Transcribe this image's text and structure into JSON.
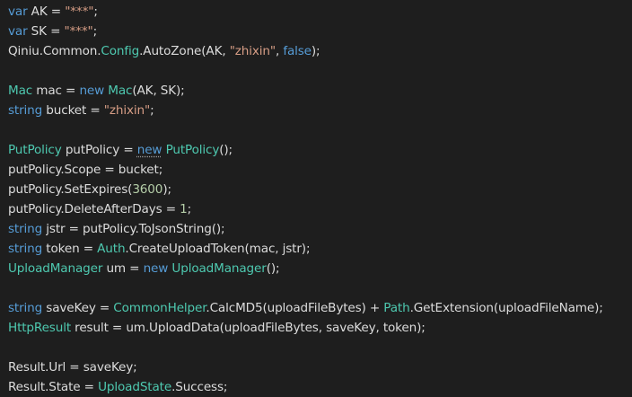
{
  "colors": {
    "background": "#1e1e1e",
    "keyword": "#569cd6",
    "type": "#4ec9b0",
    "string": "#d69d85",
    "number": "#b5cea8",
    "plain": "#dcdcdc"
  },
  "code_lines": [
    [
      {
        "t": "kw",
        "v": "var"
      },
      {
        "t": "plain",
        "v": " AK = "
      },
      {
        "t": "str",
        "v": "\"***\""
      },
      {
        "t": "plain",
        "v": ";"
      }
    ],
    [
      {
        "t": "kw",
        "v": "var"
      },
      {
        "t": "plain",
        "v": " SK = "
      },
      {
        "t": "str",
        "v": "\"***\""
      },
      {
        "t": "plain",
        "v": ";"
      }
    ],
    [
      {
        "t": "plain",
        "v": "Qiniu.Common."
      },
      {
        "t": "type",
        "v": "Config"
      },
      {
        "t": "plain",
        "v": ".AutoZone(AK, "
      },
      {
        "t": "str",
        "v": "\"zhixin\""
      },
      {
        "t": "plain",
        "v": ", "
      },
      {
        "t": "kw",
        "v": "false"
      },
      {
        "t": "plain",
        "v": ");"
      }
    ],
    [],
    [
      {
        "t": "type",
        "v": "Mac"
      },
      {
        "t": "plain",
        "v": " mac = "
      },
      {
        "t": "kw",
        "v": "new"
      },
      {
        "t": "plain",
        "v": " "
      },
      {
        "t": "type",
        "v": "Mac"
      },
      {
        "t": "plain",
        "v": "(AK, SK);"
      }
    ],
    [
      {
        "t": "kw",
        "v": "string"
      },
      {
        "t": "plain",
        "v": " bucket = "
      },
      {
        "t": "str",
        "v": "\"zhixin\""
      },
      {
        "t": "plain",
        "v": ";"
      }
    ],
    [],
    [
      {
        "t": "type",
        "v": "PutPolicy"
      },
      {
        "t": "plain",
        "v": " putPolicy = "
      },
      {
        "t": "kw-sq",
        "v": "new"
      },
      {
        "t": "plain",
        "v": " "
      },
      {
        "t": "type",
        "v": "PutPolicy"
      },
      {
        "t": "plain",
        "v": "();"
      }
    ],
    [
      {
        "t": "plain",
        "v": "putPolicy.Scope = bucket;"
      }
    ],
    [
      {
        "t": "plain",
        "v": "putPolicy.SetExpires("
      },
      {
        "t": "num",
        "v": "3600"
      },
      {
        "t": "plain",
        "v": ");"
      }
    ],
    [
      {
        "t": "plain",
        "v": "putPolicy.DeleteAfterDays = "
      },
      {
        "t": "num",
        "v": "1"
      },
      {
        "t": "plain",
        "v": ";"
      }
    ],
    [
      {
        "t": "kw",
        "v": "string"
      },
      {
        "t": "plain",
        "v": " jstr = putPolicy.ToJsonString();"
      }
    ],
    [
      {
        "t": "kw",
        "v": "string"
      },
      {
        "t": "plain",
        "v": " token = "
      },
      {
        "t": "type",
        "v": "Auth"
      },
      {
        "t": "plain",
        "v": ".CreateUploadToken(mac, jstr);"
      }
    ],
    [
      {
        "t": "type",
        "v": "UploadManager"
      },
      {
        "t": "plain",
        "v": " um = "
      },
      {
        "t": "kw",
        "v": "new"
      },
      {
        "t": "plain",
        "v": " "
      },
      {
        "t": "type",
        "v": "UploadManager"
      },
      {
        "t": "plain",
        "v": "();"
      }
    ],
    [],
    [
      {
        "t": "kw",
        "v": "string"
      },
      {
        "t": "plain",
        "v": " saveKey = "
      },
      {
        "t": "type",
        "v": "CommonHelper"
      },
      {
        "t": "plain",
        "v": ".CalcMD5(uploadFileBytes) + "
      },
      {
        "t": "type",
        "v": "Path"
      },
      {
        "t": "plain",
        "v": ".GetExtension(uploadFileName);"
      }
    ],
    [
      {
        "t": "type",
        "v": "HttpResult"
      },
      {
        "t": "plain",
        "v": " result = um.UploadData(uploadFileBytes, saveKey, token);"
      }
    ],
    [],
    [
      {
        "t": "plain",
        "v": "Result.Url = saveKey;"
      }
    ],
    [
      {
        "t": "plain",
        "v": "Result.State = "
      },
      {
        "t": "type",
        "v": "UploadState"
      },
      {
        "t": "plain",
        "v": ".Success;"
      }
    ]
  ]
}
